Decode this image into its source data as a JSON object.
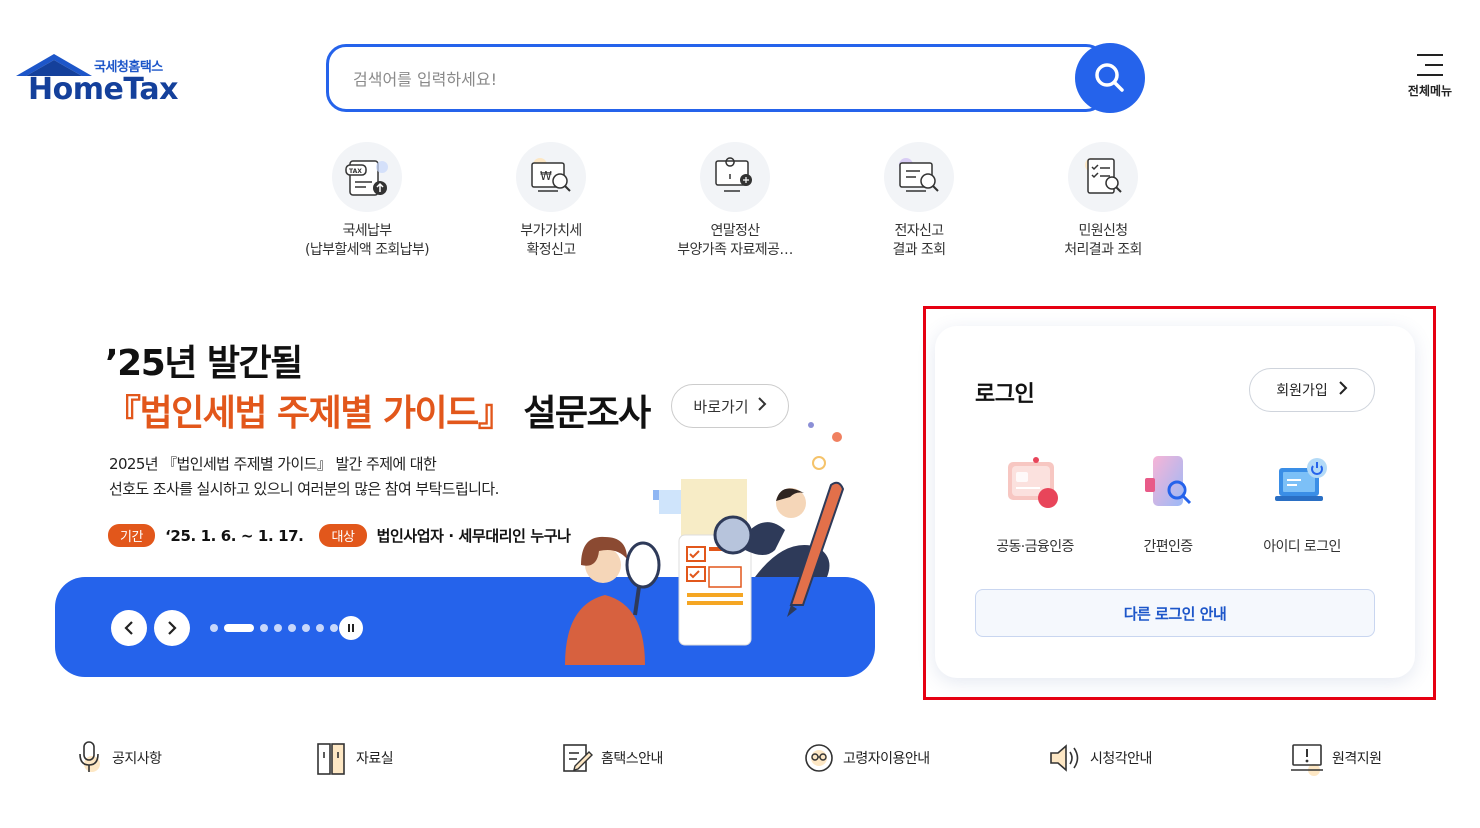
{
  "header": {
    "logo_sub": "국세청홈택스",
    "logo_main": "HomeTax",
    "search_placeholder": "검색어를 입력하세요!",
    "menu_label": "전체메뉴"
  },
  "quick_services": [
    {
      "line1": "국세납부",
      "line2": "(납부할세액 조회납부)",
      "icon": "tax-payment-icon"
    },
    {
      "line1": "부가가치세",
      "line2": "확정신고",
      "icon": "vat-report-icon"
    },
    {
      "line1": "연말정산",
      "line2": "부양가족 자료제공…",
      "icon": "year-end-settlement-icon"
    },
    {
      "line1": "전자신고",
      "line2": "결과 조회",
      "icon": "e-filing-result-icon"
    },
    {
      "line1": "민원신청",
      "line2": "처리결과 조회",
      "icon": "civil-petition-icon"
    }
  ],
  "banner": {
    "title1": "’25년 발간될",
    "title2_highlight": "『법인세법 주제별 가이드』",
    "title2_rest": " 설문조사",
    "go_label": "바로가기",
    "desc1": "2025년 『법인세법 주제별 가이드』 발간 주제에 대한",
    "desc2": "선호도 조사를 실시하고 있으니 여러분의 많은 참여 부탁드립니다.",
    "period_tag": "기간",
    "period_value": "‘25. 1. 6. ~ 1. 17.",
    "target_tag": "대상",
    "target_value": "법인사업자 · 세무대리인 누구나",
    "slide_count": 8,
    "active_slide": 2
  },
  "login": {
    "title": "로그인",
    "join_label": "회원가입",
    "options": [
      {
        "label": "공동·금융인증",
        "icon": "certificate-icon"
      },
      {
        "label": "간편인증",
        "icon": "simple-auth-icon"
      },
      {
        "label": "아이디 로그인",
        "icon": "id-login-icon"
      }
    ],
    "other_label": "다른 로그인 안내"
  },
  "footer_links": [
    {
      "label": "공지사항",
      "icon": "microphone-icon"
    },
    {
      "label": "자료실",
      "icon": "archive-icon"
    },
    {
      "label": "홈택스안내",
      "icon": "guide-icon"
    },
    {
      "label": "고령자이용안내",
      "icon": "senior-icon"
    },
    {
      "label": "시청각안내",
      "icon": "speaker-icon"
    },
    {
      "label": "원격지원",
      "icon": "remote-support-icon"
    }
  ],
  "colors": {
    "primary": "#2563eb",
    "accent": "#e2571b",
    "highlight_border": "#e60012"
  }
}
